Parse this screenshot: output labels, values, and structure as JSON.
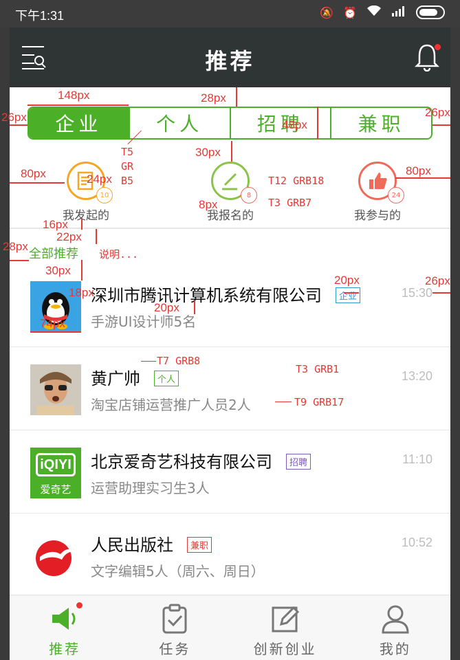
{
  "status_bar": {
    "time": "下午1:31"
  },
  "navbar": {
    "title": "推荐"
  },
  "segmented_tabs": [
    {
      "label": "企业",
      "active": true
    },
    {
      "label": "个人",
      "active": false
    },
    {
      "label": "招聘",
      "active": false
    },
    {
      "label": "兼职",
      "active": false
    }
  ],
  "quick_entries": [
    {
      "label": "我发起的",
      "badge": "10",
      "color": "#f5a623",
      "icon": "document-icon"
    },
    {
      "label": "我报名的",
      "badge": "8",
      "color": "#8bc34a",
      "icon": "edit-icon"
    },
    {
      "label": "我参与的",
      "badge": "24",
      "color": "#f06a5a",
      "icon": "thumbs-up-icon"
    }
  ],
  "section": {
    "title": "全部推荐"
  },
  "list": [
    {
      "name": "深圳市腾讯计算机系统有限公司",
      "tag": "企业",
      "tag_color": "#2e9ad0",
      "desc": "手游UI设计师5名",
      "time": "15:30",
      "avatar": "qq-logo"
    },
    {
      "name": "黄广帅",
      "tag": "个人",
      "tag_color": "#4caf28",
      "desc": "淘宝店铺运营推广人员2人",
      "time": "13:20",
      "avatar": "person-photo"
    },
    {
      "name": "北京爱奇艺科技有限公司",
      "tag": "招聘",
      "tag_color": "#7e57c2",
      "desc": "运营助理实习生3人",
      "time": "11:10",
      "avatar": "iqiyi-logo",
      "logo_top": "iQIYI",
      "logo_bottom": "爱奇艺"
    },
    {
      "name": "人民出版社",
      "tag": "兼职",
      "tag_color": "#e53935",
      "desc": "文字编辑5人（周六、周日）",
      "time": "10:52",
      "avatar": "people-press-logo"
    }
  ],
  "tabbar": [
    {
      "label": "推荐",
      "active": true,
      "icon": "megaphone-icon",
      "dot": true
    },
    {
      "label": "任务",
      "active": false,
      "icon": "clipboard-check-icon"
    },
    {
      "label": "创新创业",
      "active": false,
      "icon": "pencil-note-icon"
    },
    {
      "label": "我的",
      "active": false,
      "icon": "user-icon"
    }
  ],
  "annotations": {
    "a148": "148px",
    "a28top": "28px",
    "a26l": "26px",
    "a26r": "26px",
    "a48": "48px",
    "t5": "T5",
    "gr": "GR",
    "b5": "B5",
    "a30": "30px",
    "a80l": "80px",
    "a24": "24px",
    "t12": "T12 GRB18",
    "a80r": "80px",
    "a8": "8px",
    "t3a": "T3 GRB7",
    "a16": "16px",
    "a22": "22px",
    "a28l": "28px",
    "note": "说明...",
    "a30b": "30px",
    "a20a": "20px",
    "a26r2": "26px",
    "a18": "18px",
    "a20b": "20px",
    "a74": "74px",
    "t7": "T7 GRB8",
    "t3b": "T3 GRB1",
    "t9": "T9 GRB17"
  }
}
